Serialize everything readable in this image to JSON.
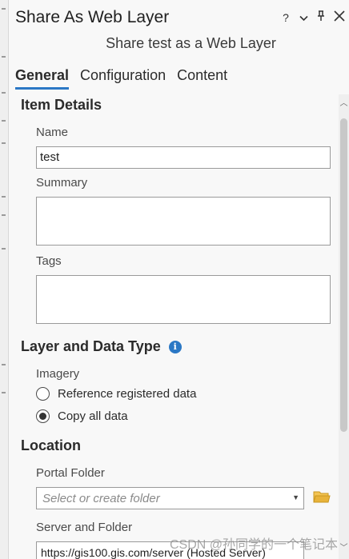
{
  "window": {
    "title": "Share As Web Layer",
    "subtitle": "Share test as a Web Layer",
    "controls": {
      "help": "?",
      "menu": "⌄",
      "pin": "⊤",
      "close": "✕"
    }
  },
  "tabs": [
    {
      "label": "General",
      "active": true
    },
    {
      "label": "Configuration",
      "active": false
    },
    {
      "label": "Content",
      "active": false
    }
  ],
  "item_details": {
    "heading": "Item Details",
    "name_label": "Name",
    "name_value": "test",
    "summary_label": "Summary",
    "summary_value": "",
    "tags_label": "Tags",
    "tags_value": ""
  },
  "layer_data_type": {
    "heading": "Layer and Data Type",
    "info_icon": "info-icon",
    "group_label": "Imagery",
    "options": [
      {
        "label": "Reference registered data",
        "checked": false
      },
      {
        "label": "Copy all data",
        "checked": true
      }
    ]
  },
  "location": {
    "heading": "Location",
    "portal_folder_label": "Portal Folder",
    "portal_folder_placeholder": "Select or create folder",
    "server_folder_label": "Server and Folder",
    "server_folder_value": "https://gis100.gis.com/server (Hosted Server)"
  },
  "watermark": "CSDN @孙同学的一个笔记本",
  "colors": {
    "accent": "#2b78c5",
    "folder": "#e8b33a"
  }
}
